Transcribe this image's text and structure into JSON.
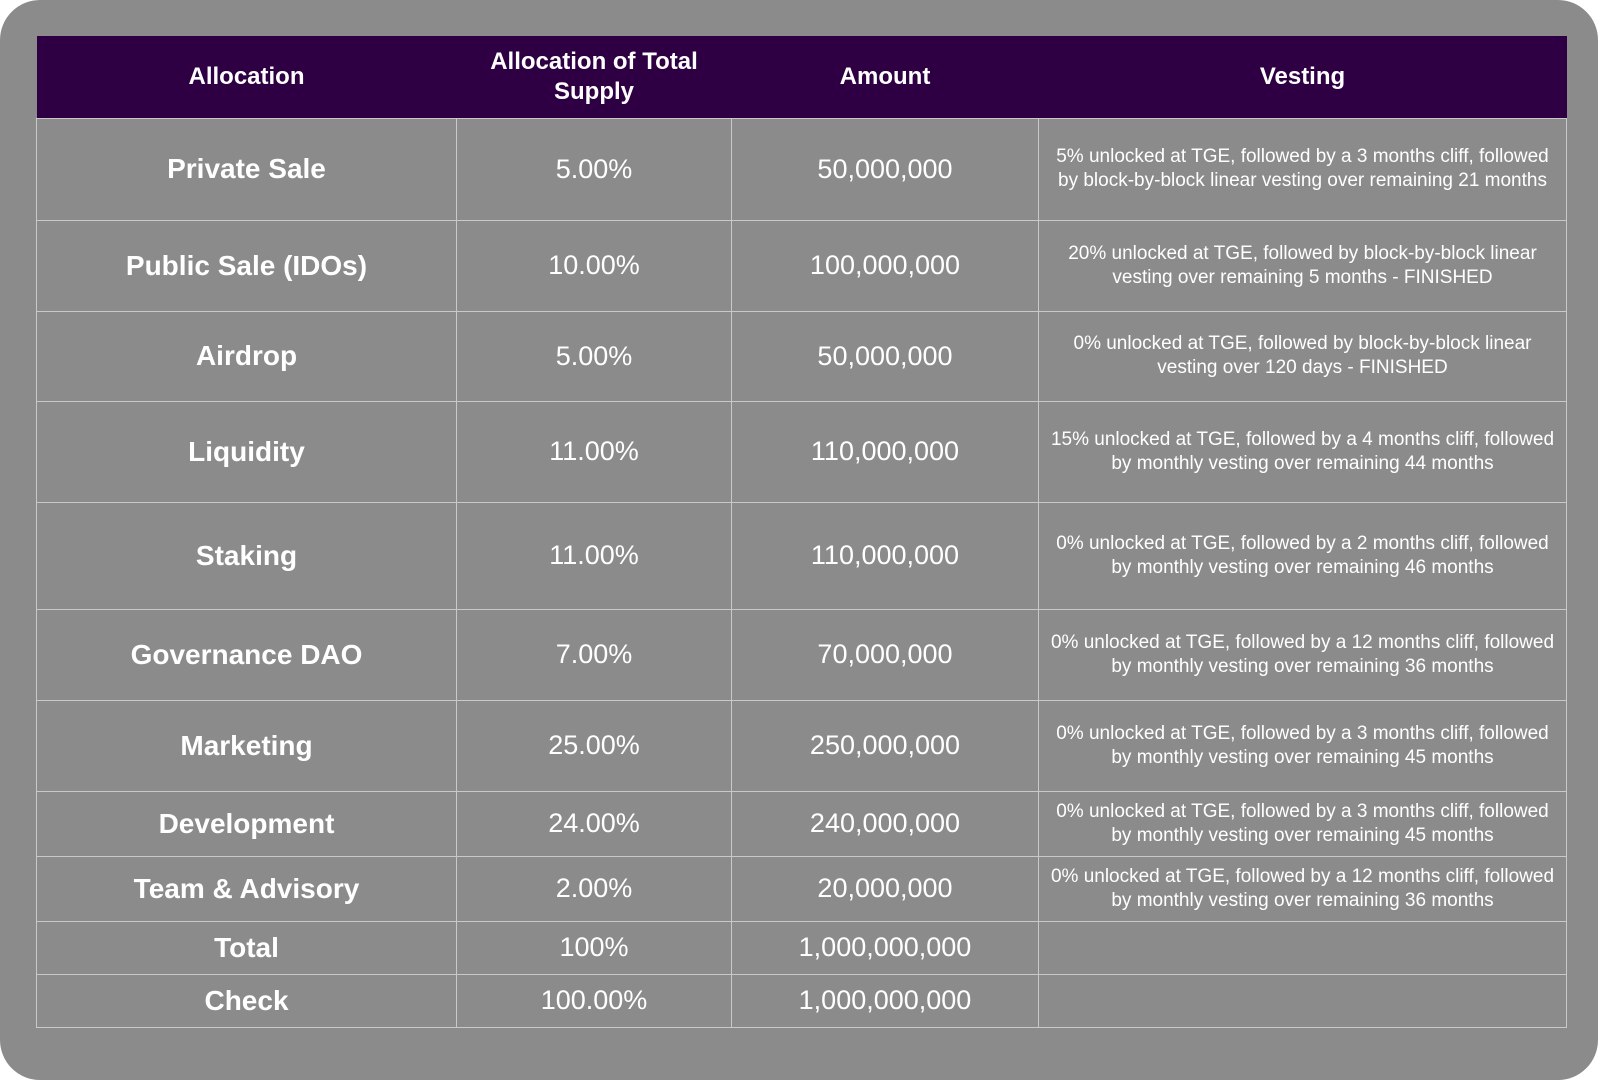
{
  "table": {
    "headers": [
      "Allocation",
      "Allocation of Total Supply",
      "Amount",
      "Vesting"
    ],
    "rows": [
      {
        "allocation": "Private Sale",
        "share": "5.00%",
        "amount": "50,000,000",
        "vesting": "5% unlocked at TGE, followed by a 3 months cliff, followed by block-by-block linear vesting over remaining 21 months"
      },
      {
        "allocation": "Public Sale (IDOs)",
        "share": "10.00%",
        "amount": "100,000,000",
        "vesting": "20% unlocked at TGE, followed by block-by-block linear vesting over remaining 5 months - FINISHED"
      },
      {
        "allocation": "Airdrop",
        "share": "5.00%",
        "amount": "50,000,000",
        "vesting": "0% unlocked at TGE, followed by block-by-block linear vesting over 120 days - FINISHED"
      },
      {
        "allocation": "Liquidity",
        "share": "11.00%",
        "amount": "110,000,000",
        "vesting": "15% unlocked at TGE, followed by a 4 months cliff, followed by monthly vesting over remaining 44 months"
      },
      {
        "allocation": "Staking",
        "share": "11.00%",
        "amount": "110,000,000",
        "vesting": "0% unlocked at TGE, followed by a 2 months cliff, followed by monthly vesting over remaining 46 months"
      },
      {
        "allocation": "Governance DAO",
        "share": "7.00%",
        "amount": "70,000,000",
        "vesting": "0% unlocked at TGE, followed by a 12 months cliff, followed by monthly vesting over remaining 36 months"
      },
      {
        "allocation": "Marketing",
        "share": "25.00%",
        "amount": "250,000,000",
        "vesting": "0% unlocked at TGE, followed by a 3 months cliff, followed by monthly vesting over remaining 45 months"
      },
      {
        "allocation": "Development",
        "share": "24.00%",
        "amount": "240,000,000",
        "vesting": "0% unlocked at TGE, followed by a 3 months cliff, followed by monthly vesting over remaining 45 months"
      },
      {
        "allocation": "Team & Advisory",
        "share": "2.00%",
        "amount": "20,000,000",
        "vesting": "0% unlocked at TGE, followed by a 12 months cliff, followed by monthly vesting over remaining 36 months"
      },
      {
        "allocation": "Total",
        "share": "100%",
        "amount": "1,000,000,000",
        "vesting": ""
      },
      {
        "allocation": "Check",
        "share": "100.00%",
        "amount": "1,000,000,000",
        "vesting": ""
      }
    ]
  },
  "colors": {
    "background": "#8b8b8b",
    "header": "#2e0043",
    "text": "#ffffff",
    "grid": "#c9c9c9"
  }
}
